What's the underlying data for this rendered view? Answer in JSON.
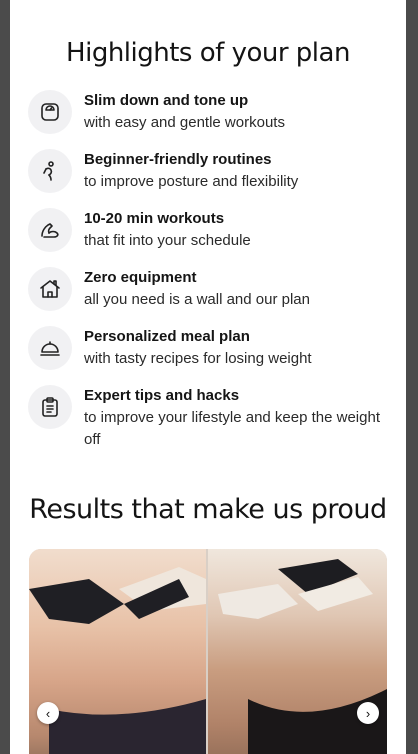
{
  "highlights": {
    "title": "Highlights of your plan",
    "items": [
      {
        "icon": "scale-icon",
        "title": "Slim down and tone up",
        "subtitle": "with easy and gentle workouts"
      },
      {
        "icon": "stretching-person-icon",
        "title": "Beginner-friendly routines",
        "subtitle": "to improve posture and flexibility"
      },
      {
        "icon": "flexed-arm-icon",
        "title": "10-20 min workouts",
        "subtitle": "that fit into your schedule"
      },
      {
        "icon": "home-icon",
        "title": "Zero equipment",
        "subtitle": "all you need is a wall and our plan"
      },
      {
        "icon": "food-cloche-icon",
        "title": "Personalized meal plan",
        "subtitle": "with tasty recipes for losing weight"
      },
      {
        "icon": "clipboard-icon",
        "title": "Expert tips and hacks",
        "subtitle": "to improve your lifestyle and keep the weight off"
      }
    ]
  },
  "results": {
    "title": "Results that make us proud",
    "prev_icon": "chevron-left-icon",
    "next_icon": "chevron-right-icon"
  }
}
